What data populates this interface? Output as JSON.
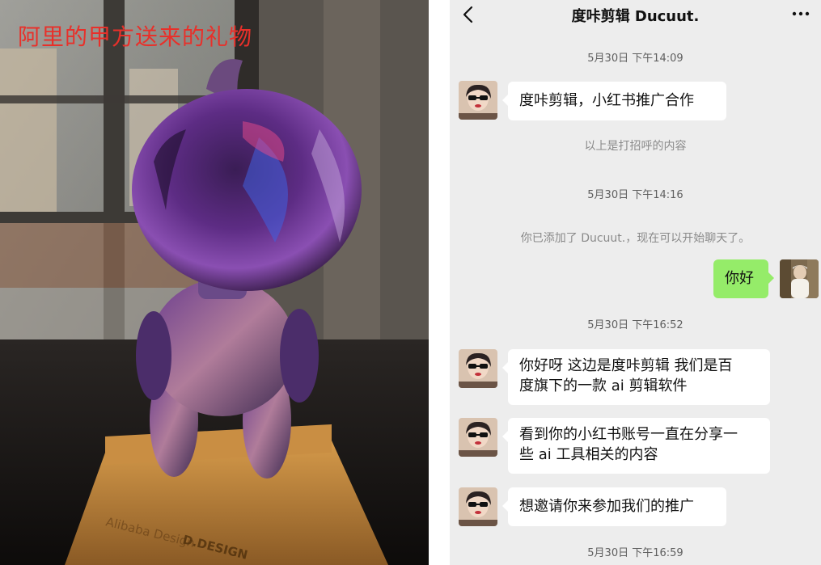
{
  "photo": {
    "caption": "阿里的甲方送来的礼物",
    "trophy_text_1": "Alibaba Design",
    "trophy_text_2": "D.DESIGN"
  },
  "chat": {
    "header": {
      "title": "度咔剪辑 Ducuut.",
      "back_icon": "chevron-left-icon",
      "more_icon": "more-dots-icon"
    },
    "messages": [
      {
        "kind": "timestamp",
        "text": "5月30日 下午14:09"
      },
      {
        "kind": "incoming",
        "text": "度咔剪辑，小红书推广合作"
      },
      {
        "kind": "system",
        "text": "以上是打招呼的内容"
      },
      {
        "kind": "timestamp",
        "text": "5月30日 下午14:16"
      },
      {
        "kind": "system",
        "text": "你已添加了 Ducuut.，现在可以开始聊天了。"
      },
      {
        "kind": "outgoing",
        "text": "你好"
      },
      {
        "kind": "timestamp",
        "text": "5月30日 下午16:52"
      },
      {
        "kind": "incoming",
        "lines": [
          "你好呀 这边是度咔剪辑 我们是百",
          "度旗下的一款 ai 剪辑软件"
        ]
      },
      {
        "kind": "incoming",
        "lines": [
          "看到你的小红书账号一直在分享一",
          "些 ai 工具相关的内容"
        ]
      },
      {
        "kind": "incoming",
        "text": "想邀请你来参加我们的推广"
      },
      {
        "kind": "timestamp",
        "text": "5月30日 下午16:59"
      }
    ]
  },
  "colors": {
    "chat_bg": "#ededed",
    "bubble_incoming": "#ffffff",
    "bubble_outgoing": "#95ec69",
    "caption_red": "#e8302a"
  }
}
